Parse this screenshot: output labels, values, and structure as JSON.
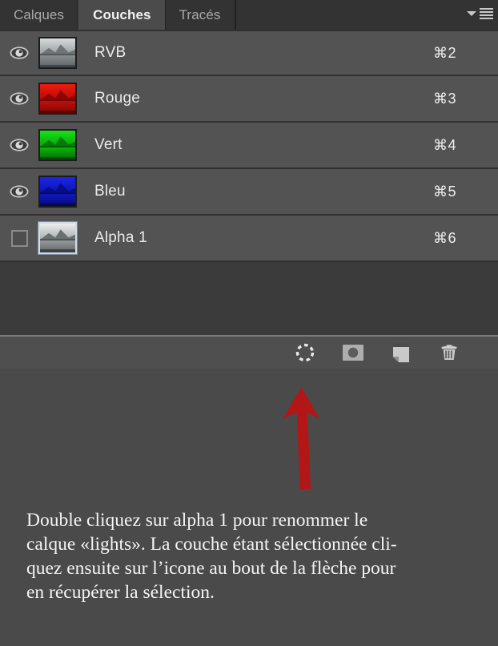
{
  "panel": {
    "tabs": [
      {
        "label": "Calques",
        "active": false
      },
      {
        "label": "Couches",
        "active": true
      },
      {
        "label": "Tracés",
        "active": false
      }
    ],
    "menu_icon": "panel-menu-icon"
  },
  "channels": [
    {
      "name": "RVB",
      "shortcut": "⌘2",
      "visible": true,
      "selected": false,
      "thumb": "rgb-composite-thumbnail",
      "tint": "gray"
    },
    {
      "name": "Rouge",
      "shortcut": "⌘3",
      "visible": true,
      "selected": false,
      "thumb": "red-channel-thumbnail",
      "tint": "red"
    },
    {
      "name": "Vert",
      "shortcut": "⌘4",
      "visible": true,
      "selected": false,
      "thumb": "green-channel-thumbnail",
      "tint": "green"
    },
    {
      "name": "Bleu",
      "shortcut": "⌘5",
      "visible": true,
      "selected": false,
      "thumb": "blue-channel-thumbnail",
      "tint": "blue"
    },
    {
      "name": "Alpha 1",
      "shortcut": "⌘6",
      "visible": false,
      "selected": true,
      "thumb": "alpha-channel-thumbnail",
      "tint": "gray"
    }
  ],
  "toolbar": {
    "buttons": [
      {
        "icon": "load-channel-as-selection-icon"
      },
      {
        "icon": "save-selection-as-channel-icon"
      },
      {
        "icon": "new-channel-icon"
      },
      {
        "icon": "delete-channel-icon"
      }
    ]
  },
  "annotation": {
    "arrow_icon": "red-arrow-up-icon",
    "arrow_color": "#b31616"
  },
  "caption": {
    "line1": "Double cliquez sur alpha 1 pour renommer le",
    "line2": "calque «lights». La couche étant sélectionnée cli-",
    "line3": "quez ensuite sur l’icone au bout de la flèche pour",
    "line4": "en récupérer la sélection."
  },
  "colors": {
    "panel_bg": "#3b3b3b",
    "row_bg": "#535353",
    "footer_bg": "#4f4f4f",
    "page_bg": "#4a4a4a",
    "tab_active_bg": "#4b4b4b",
    "text": "#eaeaea",
    "accent_red": "#b31616"
  }
}
